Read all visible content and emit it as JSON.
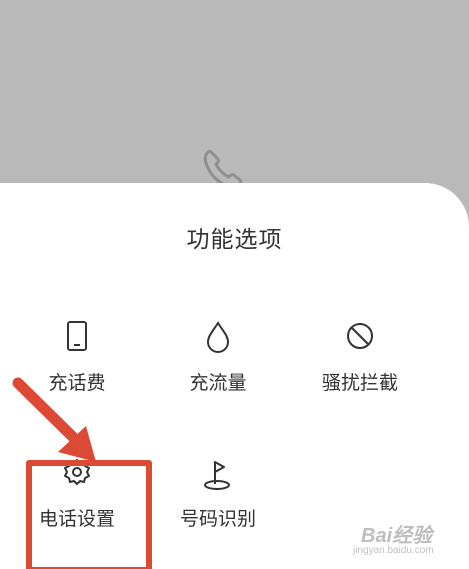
{
  "sheet": {
    "title": "功能选项",
    "options": [
      {
        "label": "充话费",
        "icon": "phone-device-icon"
      },
      {
        "label": "充流量",
        "icon": "water-drop-icon"
      },
      {
        "label": "骚扰拦截",
        "icon": "block-icon"
      },
      {
        "label": "电话设置",
        "icon": "gear-icon"
      },
      {
        "label": "号码识别",
        "icon": "location-pin-icon"
      }
    ]
  },
  "annotation": {
    "highlight_color": "#dc4a35",
    "highlighted_option": "电话设置"
  },
  "watermark": {
    "brand": "Bai经验",
    "sub": "jingyan.baidu.com"
  },
  "colors": {
    "overlay": "#b9b9b9",
    "sheet": "#ffffff",
    "text": "#333333",
    "accent": "#dc4a35"
  }
}
